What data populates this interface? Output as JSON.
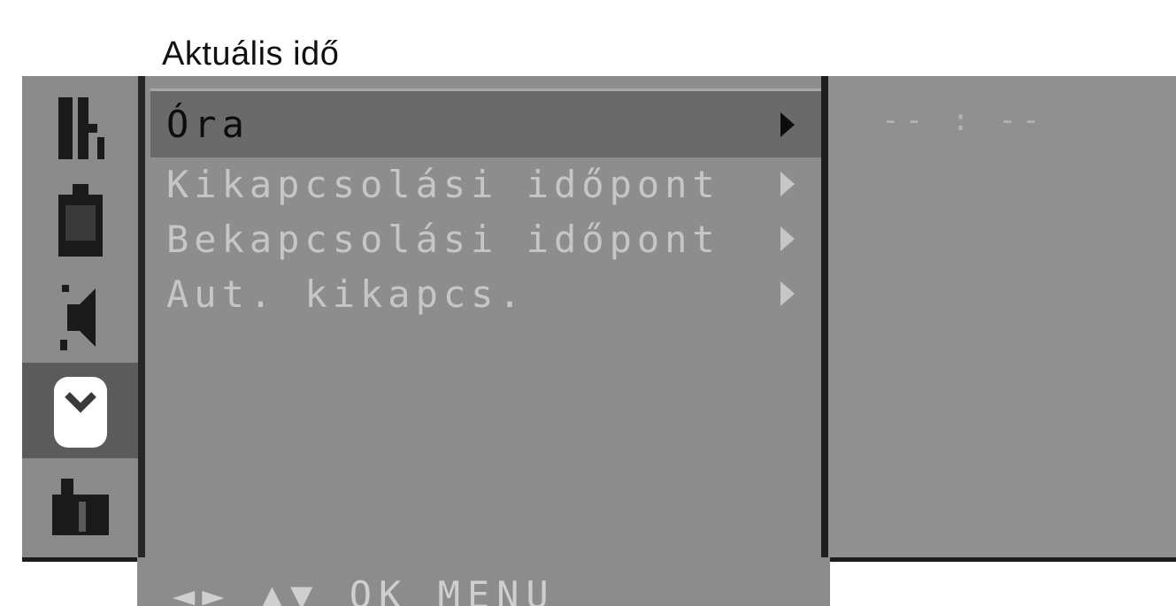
{
  "header": {
    "title": "Aktuális idő"
  },
  "rail": {
    "icons": [
      {
        "name": "channel-list-icon"
      },
      {
        "name": "picture-icon"
      },
      {
        "name": "sound-icon"
      },
      {
        "name": "timer-icon",
        "active": true
      },
      {
        "name": "setup-icon"
      }
    ]
  },
  "menu": {
    "items": [
      {
        "label": "Óra",
        "selected": true
      },
      {
        "label": "Kikapcsolási időpont"
      },
      {
        "label": "Bekapcsolási időpont"
      },
      {
        "label": "Aut. kikapcs."
      }
    ]
  },
  "submenu": {
    "value": "-- : --"
  },
  "footer": {
    "hint": "◄► ▲▼ OK MENU"
  },
  "colors": {
    "panel": "#8f8f8f",
    "selected_row": "#6a6a6a",
    "divider": "#1f1f1f",
    "text_dim": "#c6c6c6",
    "text_active": "#0d0d0d"
  }
}
